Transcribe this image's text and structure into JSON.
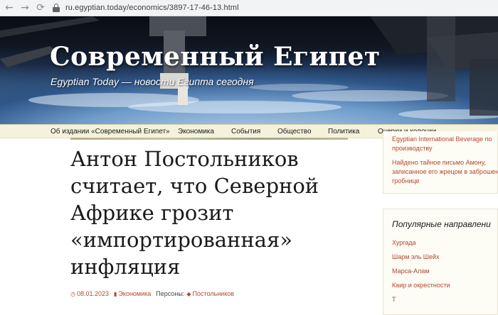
{
  "browser": {
    "back_icon": "arrow-left-icon",
    "forward_icon": "arrow-right-icon",
    "reload_icon": "reload-icon",
    "lock_icon": "lock-icon",
    "url": "ru.egyptian.today/economics/3897-17-46-13.html"
  },
  "site": {
    "title": "Современный Египет",
    "tagline": "Egyptian Today — новости Египта сегодня"
  },
  "nav": {
    "items": [
      {
        "label": "Об издании «Современный Египет»"
      },
      {
        "label": "Экономика"
      },
      {
        "label": "События"
      },
      {
        "label": "Общество"
      },
      {
        "label": "Политика"
      },
      {
        "label": "Очерки и колонки"
      }
    ]
  },
  "article": {
    "title_lines": [
      "Антон Постольников",
      "считает, что Северной",
      "Африке грозит",
      "«импортированная»",
      "инфляция"
    ],
    "date": "08.01.2023",
    "category": "Экономика",
    "persons_label": "Персоны:",
    "person": "Постольников"
  },
  "sidebar": {
    "recent": [
      {
        "lines": [
          "Egyptian International Beverage по",
          "производству"
        ]
      },
      {
        "lines": [
          "Найдено тайное письмо Амону,",
          "записанное его жрецом в заброшенн",
          "гробнице"
        ]
      }
    ],
    "popular": {
      "title": "Популярные направлени",
      "items": [
        "Хургада",
        "Шарм эль Шейх",
        "Марса-Алам",
        "Каир и окрестности",
        "Т"
      ]
    }
  },
  "colors": {
    "link": "#b5462e",
    "nav_bg": "#f5f2dc",
    "sidebar_bg": "#fdfcf5"
  }
}
